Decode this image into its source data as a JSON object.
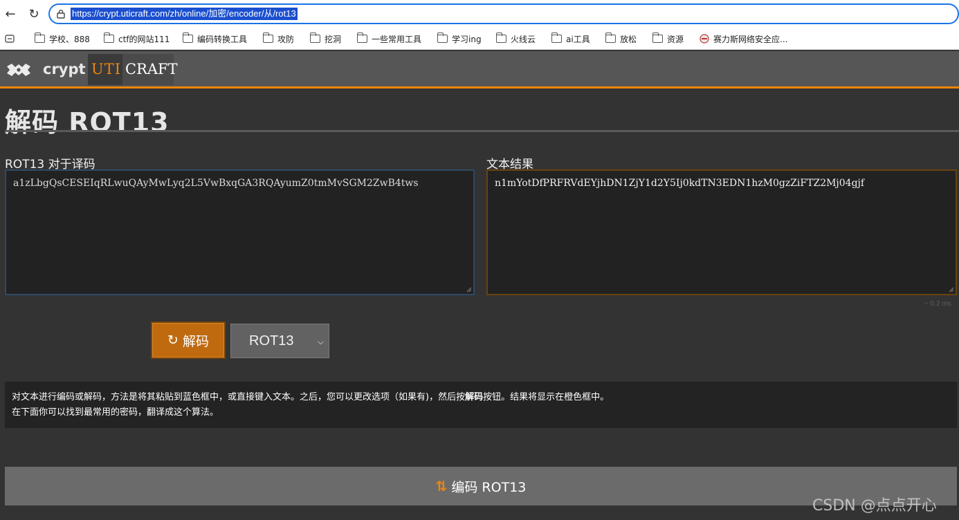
{
  "browser": {
    "url": "https://crypt.uticraft.com/zh/online/加密/encoder/从/rot13",
    "bookmarks": [
      {
        "label": "学校、888",
        "icon": "folder-icon"
      },
      {
        "label": "ctf的网站111",
        "icon": "folder-icon"
      },
      {
        "label": "编码转换工具",
        "icon": "folder-icon"
      },
      {
        "label": "攻防",
        "icon": "folder-icon"
      },
      {
        "label": "挖洞",
        "icon": "folder-icon"
      },
      {
        "label": "一些常用工具",
        "icon": "folder-icon"
      },
      {
        "label": "学习ing",
        "icon": "folder-icon"
      },
      {
        "label": "火线云",
        "icon": "folder-icon"
      },
      {
        "label": "ai工具",
        "icon": "folder-icon"
      },
      {
        "label": "放松",
        "icon": "folder-icon"
      },
      {
        "label": "资源",
        "icon": "folder-icon"
      },
      {
        "label": "赛力斯网络安全应...",
        "icon": "site-icon"
      }
    ]
  },
  "header": {
    "logo_crypt": "crypt",
    "logo_uti": "UTI",
    "logo_craft": "CRAFT"
  },
  "main": {
    "title": "解码 ROT13",
    "input_label": "ROT13 对于译码",
    "input_value": "a1zLbgQsCESEIqRLwuQAyMwLyq2L5VwBxqGA3RQAyumZ0tmMvSGM2ZwB4tws",
    "output_label": "文本结果",
    "output_value": "n1mYotDfPRFRVdEYjhDN1ZjY1d2Y5Ij0kdTN3EDN1hzM0gzZiFTZ2Mj04gjf",
    "timing": "~ 0.2 ms",
    "decode_button": "解码",
    "select_value": "ROT13",
    "info_line1_a": "对文本进行编码或解码，方法是将其粘贴到蓝色框中，或直接键入文本。之后，您可以更改选项（如果有)，然后按",
    "info_line1_b": "解码",
    "info_line1_c": "按钮。结果将显示在橙色框中。",
    "info_line2": "在下面你可以找到最常用的密码，翻译成这个算法。",
    "encode_bar_label": "编码 ROT13"
  },
  "watermark": "CSDN @点点开心",
  "colors": {
    "accent": "#f0850d",
    "decode_button": "#c06a10",
    "input_border": "#2e4a66",
    "output_border": "#6a4310"
  }
}
